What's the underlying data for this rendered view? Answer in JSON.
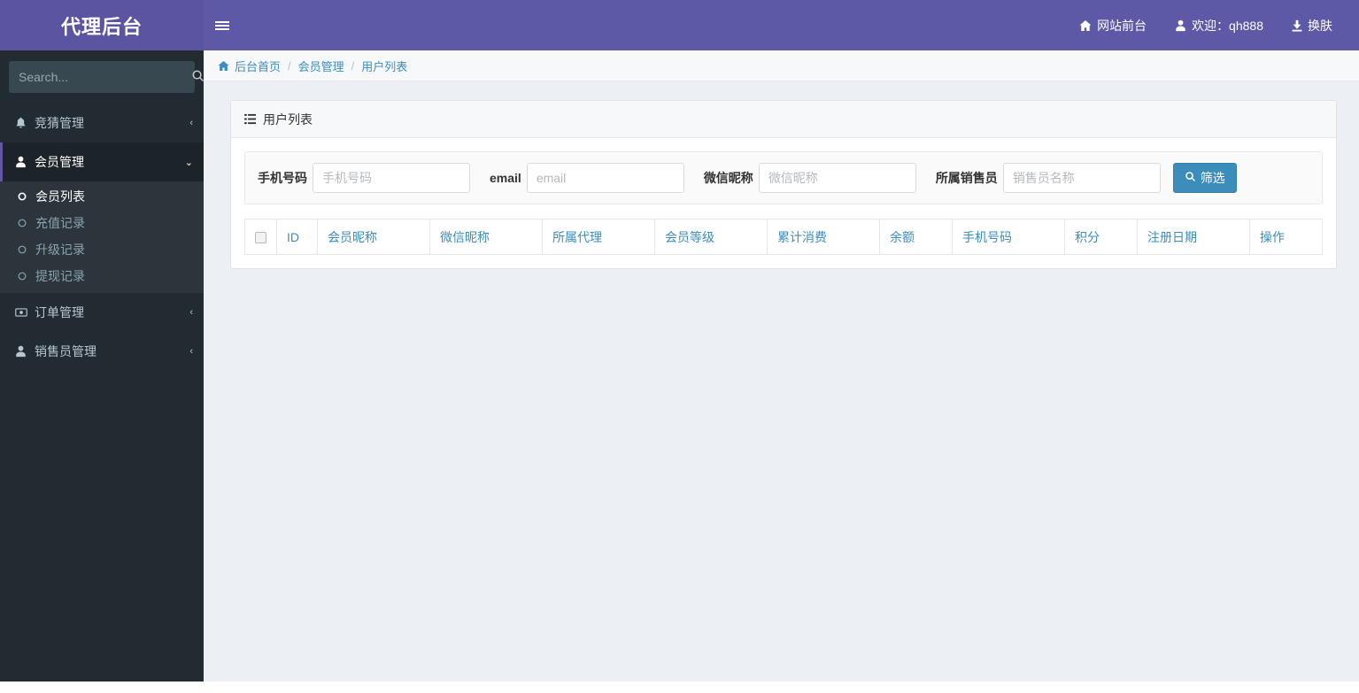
{
  "brand": {
    "title": "代理后台",
    "logo_bg": "#5B54A0"
  },
  "theme": {
    "header_bg": "#5D59A6",
    "sidebar_bg": "#232B32",
    "accent": "#3C8DBC",
    "content_bg": "#ECEFF4"
  },
  "sidebar": {
    "search": {
      "placeholder": "Search...",
      "value": "",
      "icon": "search-icon"
    },
    "items": [
      {
        "label": "竞猜管理",
        "icon": "bell-icon",
        "arrow": "‹",
        "active": false
      },
      {
        "label": "会员管理",
        "icon": "user-icon",
        "arrow": "⌄",
        "active": true
      },
      {
        "label": "订单管理",
        "icon": "money-icon",
        "arrow": "‹",
        "active": false
      },
      {
        "label": "销售员管理",
        "icon": "user-icon",
        "arrow": "‹",
        "active": false
      }
    ],
    "submenu": [
      {
        "label": "会员列表",
        "icon": "circle-o-icon",
        "active": true
      },
      {
        "label": "充值记录",
        "icon": "circle-o-icon",
        "active": false
      },
      {
        "label": "升级记录",
        "icon": "circle-o-icon",
        "active": false
      },
      {
        "label": "提现记录",
        "icon": "circle-o-icon",
        "active": false
      }
    ]
  },
  "header": {
    "toggle_icon": "hamburger-icon",
    "right_items": [
      {
        "label": "网站前台",
        "icon": "home-icon"
      },
      {
        "label": "欢迎：qh888",
        "icon": "user-icon"
      },
      {
        "label": "换肤",
        "icon": "download-icon"
      }
    ]
  },
  "breadcrumb": {
    "home_icon": "home-icon",
    "items": [
      "后台首页",
      "会员管理",
      "用户列表"
    ],
    "separator": "/"
  },
  "panel": {
    "title": "用户列表",
    "icon": "list-icon"
  },
  "filters": {
    "phone": {
      "label": "手机号码",
      "placeholder": "手机号码",
      "value": ""
    },
    "email": {
      "label": "email",
      "placeholder": "email",
      "value": ""
    },
    "wechat": {
      "label": "微信昵称",
      "placeholder": "微信昵称",
      "value": ""
    },
    "sales": {
      "label": "所属销售员",
      "placeholder": "销售员名称",
      "value": ""
    },
    "submit": {
      "label": "筛选",
      "icon": "search-icon"
    }
  },
  "table": {
    "select_all": "",
    "columns": [
      "ID",
      "会员昵称",
      "微信昵称",
      "所属代理",
      "会员等级",
      "累计消费",
      "余额",
      "手机号码",
      "积分",
      "注册日期",
      "操作"
    ],
    "rows": []
  }
}
